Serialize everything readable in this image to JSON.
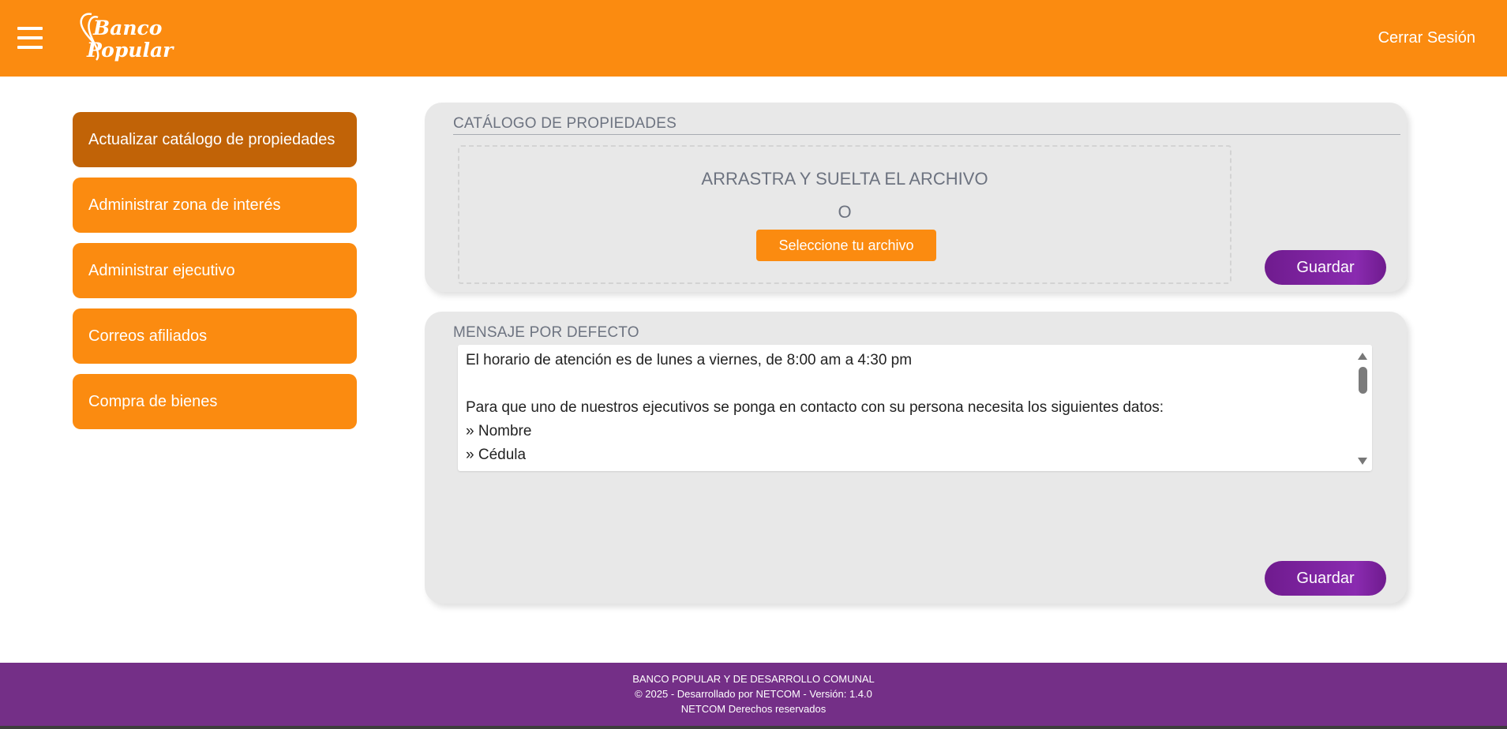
{
  "header": {
    "logo_text": "Banco Popular",
    "logout_label": "Cerrar Sesión",
    "menu_icon": "hamburger-menu-icon",
    "colors": {
      "header_bg": "#fb8b10"
    }
  },
  "sidebar": {
    "items": [
      {
        "label": "Actualizar catálogo de propiedades",
        "active": true
      },
      {
        "label": "Administrar zona de interés",
        "active": false
      },
      {
        "label": "Administrar ejecutivo",
        "active": false
      },
      {
        "label": "Correos afiliados",
        "active": false
      },
      {
        "label": "Compra de bienes",
        "active": false
      }
    ],
    "colors": {
      "item_bg": "#fb8b10",
      "active_bg": "#c16307"
    }
  },
  "catalog_panel": {
    "title": "CATÁLOGO DE PROPIEDADES",
    "drop_text": "ARRASTRA Y SUELTA EL ARCHIVO",
    "or_text": "O",
    "select_button": "Seleccione tu archivo",
    "save_button": "Guardar"
  },
  "message_panel": {
    "title": "MENSAJE POR DEFECTO",
    "message": "El horario de atención es de lunes a viernes, de 8:00 am a 4:30 pm\n\nPara que uno de nuestros ejecutivos se ponga en contacto con su persona necesita los siguientes datos:\n» Nombre\n» Cédula",
    "save_button": "Guardar",
    "colors": {
      "save_bg": "#7a1f99"
    }
  },
  "footer": {
    "line1": "BANCO POPULAR Y DE DESARROLLO COMUNAL",
    "line2": "© 2025 - Desarrollado por NETCOM - Versión: 1.4.0",
    "line3": "NETCOM Derechos reservados",
    "colors": {
      "footer_bg": "#742f87"
    }
  }
}
